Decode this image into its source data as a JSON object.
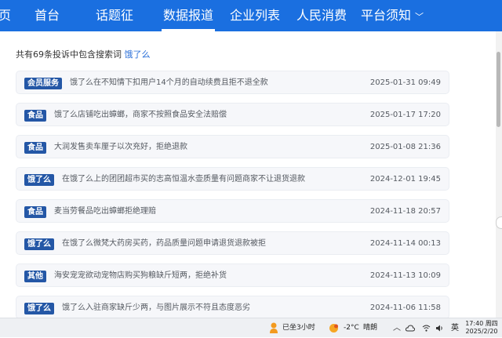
{
  "nav": {
    "items": [
      "页",
      "首台",
      "话题征",
      "数据报道",
      "企业列表",
      "人民消费",
      "平台须知"
    ],
    "active_index": 3,
    "accent": "#1a6fe0"
  },
  "summary": {
    "prefix": "共有69条投诉中包含搜索词",
    "keyword": "饿了么"
  },
  "complaints": [
    {
      "tag": "会员服务",
      "title": "饿了么在不知情下扣用户14个月的自动续费且拒不退全款",
      "date": "2025-01-31 09:49"
    },
    {
      "tag": "食品",
      "title": "饿了么店铺吃出蟑螂，商家不按照食品安全法赔偿",
      "date": "2025-01-17 17:20"
    },
    {
      "tag": "食品",
      "title": "大润发售卖车厘子以次充好，拒绝退款",
      "date": "2025-01-08 21:36"
    },
    {
      "tag": "饿了么",
      "title": "在饿了么上的团团超市买的志高恒温水壶质量有问题商家不让退货退款",
      "date": "2024-12-01 19:45"
    },
    {
      "tag": "食品",
      "title": "麦当劳餐品吃出蟑螂拒绝理赔",
      "date": "2024-11-18 20:57"
    },
    {
      "tag": "饿了么",
      "title": "在饿了么微梵大药房买药，药品质量问题申请退货退款被拒",
      "date": "2024-11-14 00:13"
    },
    {
      "tag": "其他",
      "title": "海安宠宠欲动宠物店购买狗粮缺斤短两，拒绝补货",
      "date": "2024-11-13 10:09"
    },
    {
      "tag": "饿了么",
      "title": "饿了么入驻商家缺斤少两，与图片展示不符且态度恶劣",
      "date": "2024-11-06 11:58"
    }
  ],
  "taskbar": {
    "status_text": "已坐3小时",
    "weather_temp": "-2°C",
    "weather_desc": "晴朗",
    "input_method": "英",
    "time": "17:40 周四",
    "date": "2025/2/20"
  },
  "icons": [
    "chevron-down-icon",
    "person-icon",
    "weather-sun-icon",
    "chevron-up-icon",
    "cloud-icon",
    "wifi-icon",
    "speaker-icon",
    "notification-icon"
  ],
  "colors": {
    "tag_bg": "#2457a6",
    "keyword": "#2a6fd8"
  }
}
